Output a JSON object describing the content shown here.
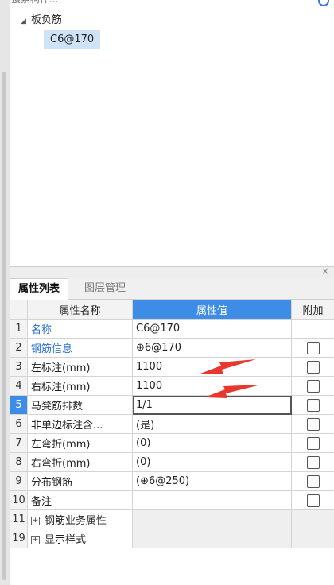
{
  "search": {
    "placeholder": "搜索构件..."
  },
  "tree": {
    "root_label": "板负筋",
    "child_label": "C6@170"
  },
  "panel": {
    "close_symbol": "×"
  },
  "tabs": [
    {
      "label": "属性列表"
    },
    {
      "label": "图层管理"
    }
  ],
  "grid": {
    "headers": {
      "name": "属性名称",
      "value": "属性值",
      "extra": "附加"
    },
    "rows": [
      {
        "idx": "1",
        "name": "名称",
        "value": "C6@170"
      },
      {
        "idx": "2",
        "name": "钢筋信息",
        "value": "⊕6@170"
      },
      {
        "idx": "3",
        "name": "左标注(mm)",
        "value": "1100"
      },
      {
        "idx": "4",
        "name": "右标注(mm)",
        "value": "1100"
      },
      {
        "idx": "5",
        "name": "马凳筋排数",
        "value": "1/1"
      },
      {
        "idx": "6",
        "name": "非单边标注含...",
        "value": "(是)"
      },
      {
        "idx": "7",
        "name": "左弯折(mm)",
        "value": "(0)"
      },
      {
        "idx": "8",
        "name": "右弯折(mm)",
        "value": "(0)"
      },
      {
        "idx": "9",
        "name": "分布钢筋",
        "value": "(⊕6@250)"
      },
      {
        "idx": "10",
        "name": "备注",
        "value": ""
      }
    ],
    "groups": [
      {
        "idx": "11",
        "name": "钢筋业务属性"
      },
      {
        "idx": "19",
        "name": "显示样式"
      }
    ]
  },
  "colors": {
    "accent": "#3d8ce6",
    "link": "#2a6fcf",
    "annotation_arrow": "#e8372c"
  }
}
